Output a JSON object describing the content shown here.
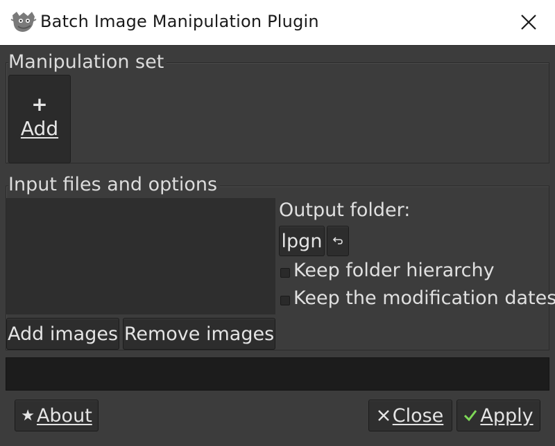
{
  "window": {
    "title": "Batch Image Manipulation Plugin"
  },
  "manipulation_set": {
    "label": "Manipulation set",
    "add_label": "Add"
  },
  "input_files": {
    "label": "Input files and options",
    "add_images": "Add images",
    "remove_images": "Remove images"
  },
  "output": {
    "label": "Output folder:",
    "folder": "lpgn",
    "keep_hierarchy": "Keep folder hierarchy",
    "keep_hierarchy_checked": false,
    "keep_dates": "Keep the modification dates",
    "keep_dates_checked": false
  },
  "progress": {
    "fraction": 0
  },
  "footer": {
    "about": "About",
    "close": "Close",
    "apply": "Apply"
  },
  "colors": {
    "background": "#3c3c3c",
    "titlebar": "#ffffff",
    "apply_check": "#7ed957"
  },
  "icons": [
    "gimp-icon",
    "close-icon",
    "plus-icon",
    "reset-folder-icon",
    "star-icon",
    "close-x-icon",
    "check-icon"
  ]
}
